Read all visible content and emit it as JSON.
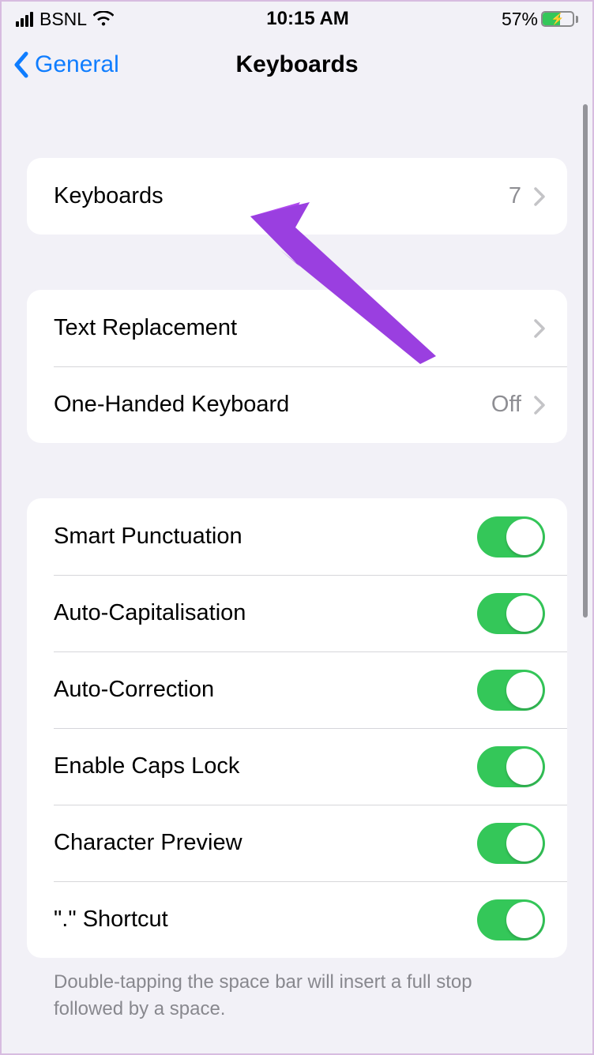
{
  "status": {
    "carrier": "BSNL",
    "time": "10:15 AM",
    "battery_pct": "57%"
  },
  "nav": {
    "back_label": "General",
    "title": "Keyboards"
  },
  "group1": {
    "keyboards_label": "Keyboards",
    "keyboards_count": "7"
  },
  "group2": {
    "text_replacement_label": "Text Replacement",
    "one_handed_label": "One-Handed Keyboard",
    "one_handed_value": "Off"
  },
  "group3": {
    "smart_punct": "Smart Punctuation",
    "auto_cap": "Auto-Capitalisation",
    "auto_correct": "Auto-Correction",
    "caps_lock": "Enable Caps Lock",
    "char_preview": "Character Preview",
    "shortcut": "\".\" Shortcut"
  },
  "footer": "Double-tapping the space bar will insert a full stop followed by a space."
}
